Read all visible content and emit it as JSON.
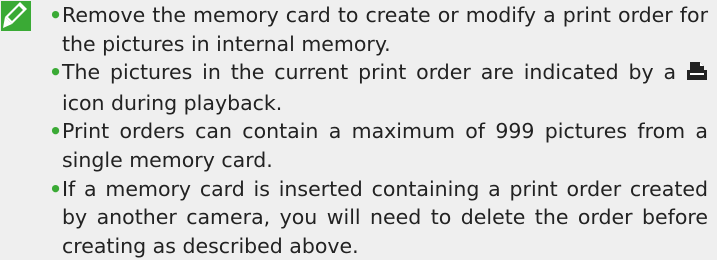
{
  "note": {
    "icon": "note-pencil-icon",
    "accent_color": "#3aaa35",
    "background_color": "#efefef",
    "bullet_glyph": "•",
    "items": [
      {
        "text": "Remove the memory card to create or modify a print order for the pictures in internal memory."
      },
      {
        "text_before": "The pictures in the current print order are indicated by a",
        "inline_icon": "print-order-icon",
        "text_after": "icon during playback."
      },
      {
        "text": "Print orders can contain a maximum of 999 pictures from a single memory card."
      },
      {
        "text": "If a memory card is inserted containing a print order created by an­other camera, you will need to delete the order before creating as described above."
      }
    ]
  }
}
